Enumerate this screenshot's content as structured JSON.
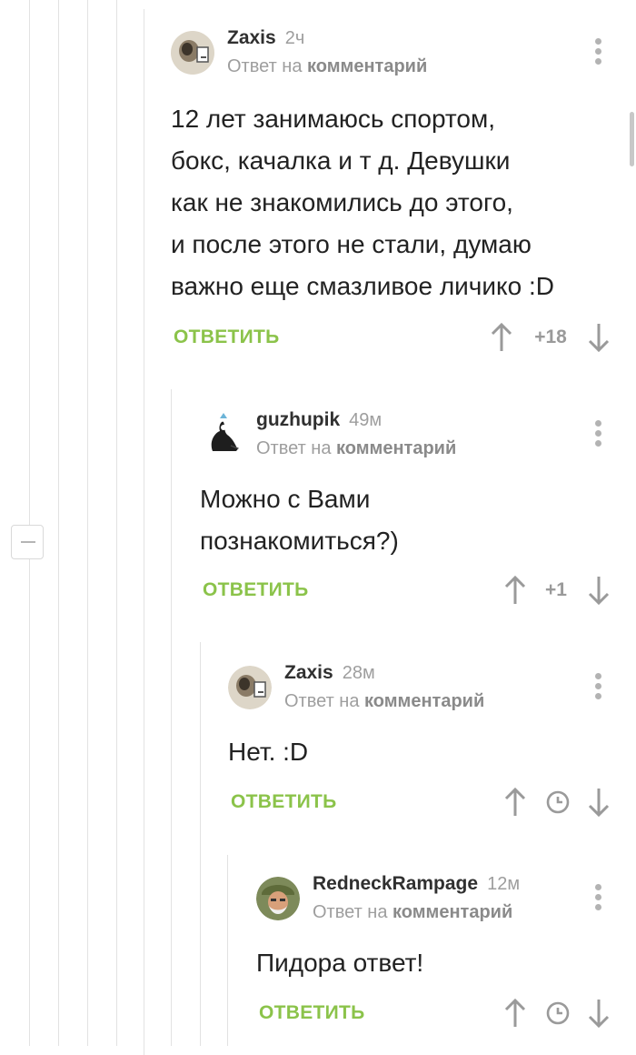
{
  "comments": [
    {
      "username": "Zaxis",
      "time": "2ч",
      "reply_prefix": "Ответ на",
      "reply_target": "комментарий",
      "lines": [
        "12 лет занимаюсь спортом,",
        "бокс, качалка и т д. Девушки",
        "как не знакомились до этого,",
        "и  после этого не стали, думаю",
        "важно еще смазливое личико :D"
      ],
      "reply_label": "ОТВЕТИТЬ",
      "rating": "+18",
      "avatar_icon": "avatar-zaxis"
    },
    {
      "username": "guzhupik",
      "time": "49м",
      "reply_prefix": "Ответ на",
      "reply_target": "комментарий",
      "lines": [
        "Можно с Вами",
        "познакомиться?)"
      ],
      "reply_label": "ОТВЕТИТЬ",
      "rating": "+1",
      "avatar_icon": "avatar-guzhupik"
    },
    {
      "username": "Zaxis",
      "time": "28м",
      "reply_prefix": "Ответ на",
      "reply_target": "комментарий",
      "lines": [
        "Нет. :D"
      ],
      "reply_label": "ОТВЕТИТЬ",
      "rating_icon": "clock-icon",
      "avatar_icon": "avatar-zaxis"
    },
    {
      "username": "RedneckRampage",
      "time": "12м",
      "reply_prefix": "Ответ на",
      "reply_target": "комментарий",
      "lines": [
        "Пидора ответ!"
      ],
      "reply_label": "ОТВЕТИТЬ",
      "rating_icon": "clock-icon",
      "avatar_icon": "avatar-redneck"
    }
  ],
  "icons": {
    "upvote": "arrow-up-icon",
    "downvote": "arrow-down-icon",
    "menu": "more-vertical-icon",
    "collapse": "minus-icon"
  },
  "colors": {
    "reply_button": "#8bc34a",
    "muted_text": "#9e9e9e",
    "thread_line": "#e2e2e2"
  }
}
